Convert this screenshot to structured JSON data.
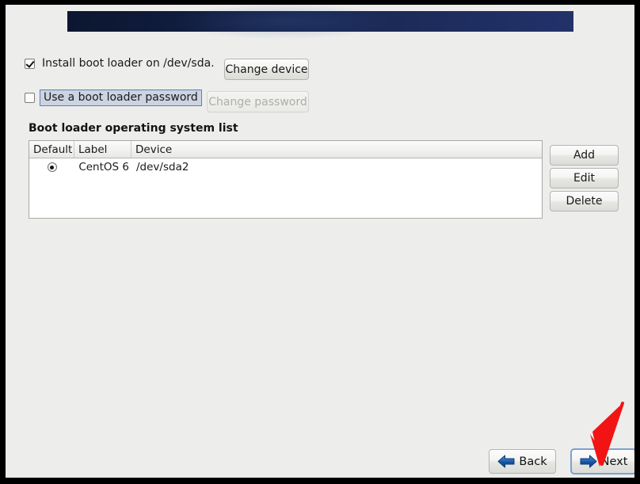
{
  "window": {
    "frame_color": "#ededeb",
    "border_color": "#000000"
  },
  "header": {
    "banner_gradient_from": "#0c1630",
    "banner_gradient_to": "#22326a",
    "title": ""
  },
  "options": {
    "install_bootloader": {
      "label": "Install boot loader on /dev/sda.",
      "checked": true,
      "button_label": "Change device",
      "button_enabled": true
    },
    "use_password": {
      "label": "Use a boot loader password",
      "checked": false,
      "focused": true,
      "button_label": "Change password",
      "button_enabled": false
    }
  },
  "os_list": {
    "heading": "Boot loader operating system list",
    "columns": [
      "Default",
      "Label",
      "Device"
    ],
    "rows": [
      {
        "default": true,
        "label": "CentOS 6",
        "device": "/dev/sda2"
      }
    ],
    "side_buttons": [
      {
        "label": "Add"
      },
      {
        "label": "Edit"
      },
      {
        "label": "Delete"
      }
    ]
  },
  "navigation": {
    "back": {
      "label": "Back",
      "icon": "arrow-left-icon",
      "icon_color": "#1b5fae"
    },
    "next": {
      "label": "Next",
      "icon": "arrow-right-icon",
      "icon_color": "#1b5fae",
      "focused": true,
      "focus_color": "#7da0d0"
    }
  },
  "annotation": {
    "arrow_color": "#f01818",
    "target": "next-button"
  }
}
